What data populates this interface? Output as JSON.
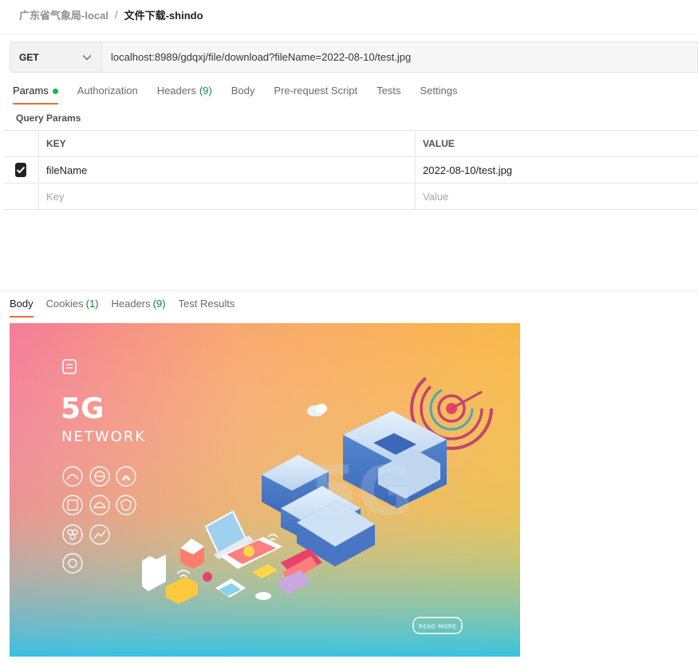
{
  "breadcrumb": {
    "workspace": "广东省气象局-local",
    "separator": "/",
    "request_name": "文件下载-shindo"
  },
  "request": {
    "method": "GET",
    "url": "localhost:8989/gdqxj/file/download?fileName=2022-08-10/test.jpg"
  },
  "request_tabs": [
    {
      "label": "Params",
      "active": true,
      "indicator": true
    },
    {
      "label": "Authorization"
    },
    {
      "label": "Headers",
      "count": "(9)"
    },
    {
      "label": "Body"
    },
    {
      "label": "Pre-request Script"
    },
    {
      "label": "Tests"
    },
    {
      "label": "Settings"
    }
  ],
  "query_params": {
    "section_title": "Query Params",
    "headers": {
      "key": "KEY",
      "value": "VALUE"
    },
    "rows": [
      {
        "checked": true,
        "key": "fileName",
        "value": "2022-08-10/test.jpg"
      }
    ],
    "new_row": {
      "key_placeholder": "Key",
      "value_placeholder": "Value"
    }
  },
  "response_tabs": [
    {
      "label": "Body",
      "active": true
    },
    {
      "label": "Cookies",
      "count": "(1)"
    },
    {
      "label": "Headers",
      "count": "(9)"
    },
    {
      "label": "Test Results"
    }
  ],
  "preview_image": {
    "headline": "5G",
    "subtitle": "NETWORK",
    "center_text": "5G",
    "button_text": "READ MORE"
  },
  "colors": {
    "accent": "#f26b3a",
    "count_green": "#0b8a3c",
    "dot_green": "#0cbb52"
  }
}
